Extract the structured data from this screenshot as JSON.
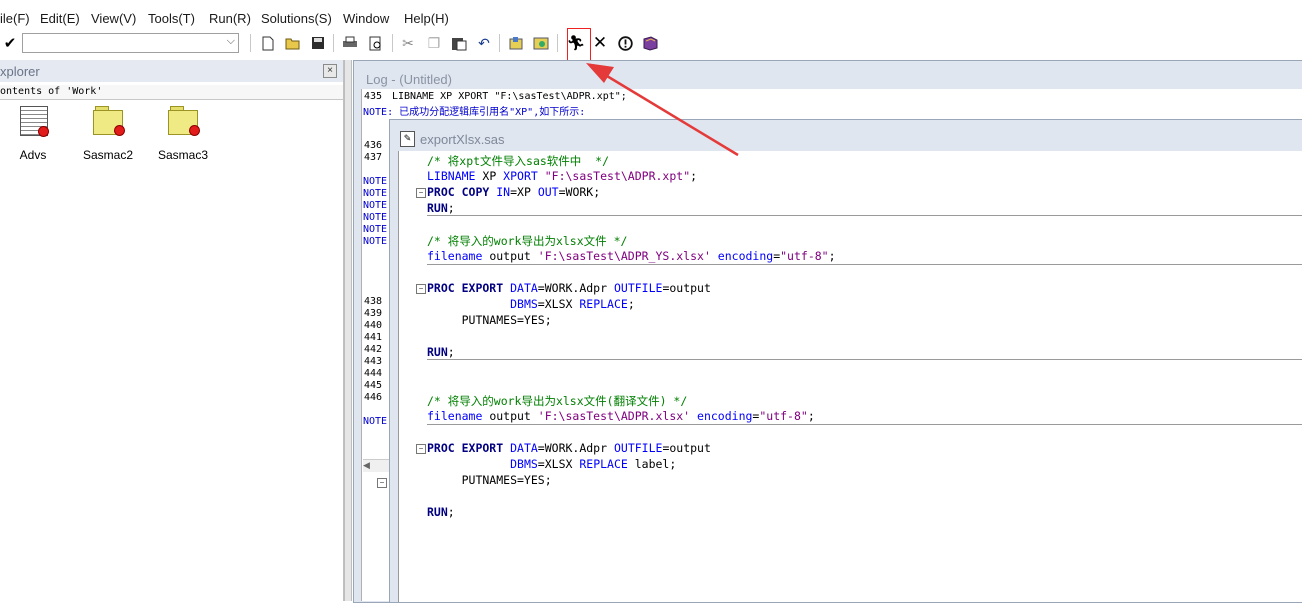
{
  "menu": [
    "ile(F)",
    "Edit(E)",
    "View(V)",
    "Tools(T)",
    "Run(R)",
    "Solutions(S)",
    "Window",
    "Help(H)"
  ],
  "toolbar": {
    "command_value": "",
    "icons": [
      "check-icon",
      "new-icon",
      "open-icon",
      "save-icon",
      "print-icon",
      "print-preview-icon",
      "cut-icon",
      "copy-icon",
      "paste-icon",
      "undo-icon",
      "libraries-icon",
      "explorer-icon",
      "run-icon",
      "clear-icon",
      "break-icon",
      "help-icon"
    ]
  },
  "explorer": {
    "title": "xplorer",
    "path": "ontents of 'Work'",
    "close": "×",
    "libraries": [
      "Advs",
      "Sasmac2",
      "Sasmac3"
    ]
  },
  "log": {
    "title": "Log - (Untitled)",
    "line1_num": "435",
    "line1_text": "LIBNAME XP XPORT \"F:\\sasTest\\ADPR.xpt\";",
    "note1": "NOTE: 已成功分配逻辑库引用名\"XP\",如下所示:",
    "line_nums_top": [
      "436",
      "437"
    ],
    "notes_block": [
      "NOTE:",
      "NOTE:",
      "NOTE:",
      "NOTE:",
      "NOTE:",
      "NOTE:"
    ],
    "line_nums_mid": [
      "438",
      "439",
      "440",
      "441",
      "442",
      "443",
      "444",
      "445",
      "446"
    ],
    "note_last": "NOTE:"
  },
  "editor": {
    "title": "exportXlsx.sas",
    "code": {
      "c1": "/* 将xpt文件导入sas软件中  */",
      "l1_kw": "LIBNAME",
      "l1_a": " XP ",
      "l1_op": "XPORT",
      "l1_st": " \"F:\\sasTest\\ADPR.xpt\"",
      "l1_end": ";",
      "p1_kw": "PROC COPY",
      "p1_a": " ",
      "p1_op1": "IN",
      "p1_b": "=XP ",
      "p1_op2": "OUT",
      "p1_c": "=WORK;",
      "run": "RUN",
      "semi": ";",
      "c2": "/* 将导入的work导出为xlsx文件 */",
      "f1_op": "filename",
      "f1_a": " output ",
      "f1_st": "'F:\\sasTest\\ADPR_YS.xlsx'",
      "f1_op2": " encoding",
      "f1_b": "=",
      "f1_st2": "\"utf-8\"",
      "e1_kw": "PROC EXPORT",
      "e1_op1": " DATA",
      "e1_a": "=WORK.Adpr ",
      "e1_op2": "OUTFILE",
      "e1_b": "=output",
      "e1_ind": "            ",
      "e1_op3": "DBMS",
      "e1_c": "=XLSX ",
      "e1_op4": "REPLACE",
      "e1_d": ";",
      "put": "     PUTNAMES=YES;",
      "c3": "/* 将导入的work导出为xlsx文件(翻译文件) */",
      "f2_st": "'F:\\sasTest\\ADPR.xlsx'",
      "e2_d": " label;"
    }
  }
}
